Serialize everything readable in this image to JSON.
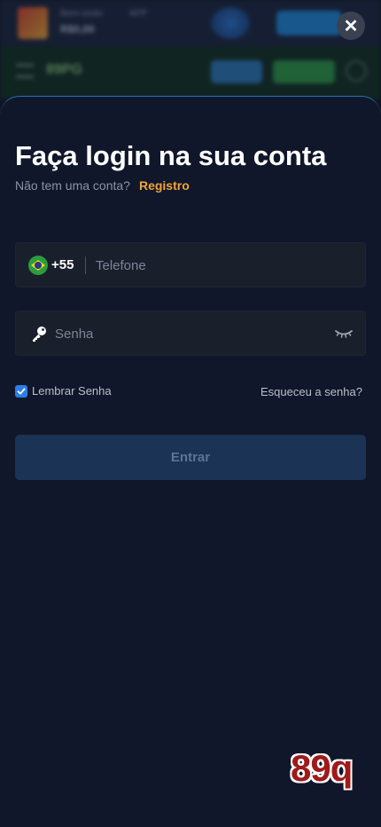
{
  "background": {
    "banner_line1": "Bem-vindo",
    "banner_line2": "R$0,00",
    "banner_line3": "APP",
    "brand": "89PG"
  },
  "close": {
    "icon": "close-icon",
    "glyph": "✕"
  },
  "login": {
    "title": "Faça login na sua conta",
    "no_account": "Não tem uma conta?",
    "register_link": "Registro",
    "phone": {
      "country_flag": "brazil-flag-icon",
      "dial_code": "+55",
      "placeholder": "Telefone",
      "value": ""
    },
    "password": {
      "placeholder": "Senha",
      "value": "",
      "visibility_icon": "eye-closed-icon"
    },
    "remember_label": "Lembrar Senha",
    "remember_checked": true,
    "forgot_label": "Esqueceu a senha?",
    "submit_label": "Entrar"
  },
  "watermark": "89q",
  "colors": {
    "sheet_bg": "#11172a",
    "field_bg": "#1a1f2c",
    "accent_link": "#f0a53a",
    "checkbox": "#2b7de9",
    "button_bg": "#1b3354",
    "button_text": "#5c7594"
  }
}
